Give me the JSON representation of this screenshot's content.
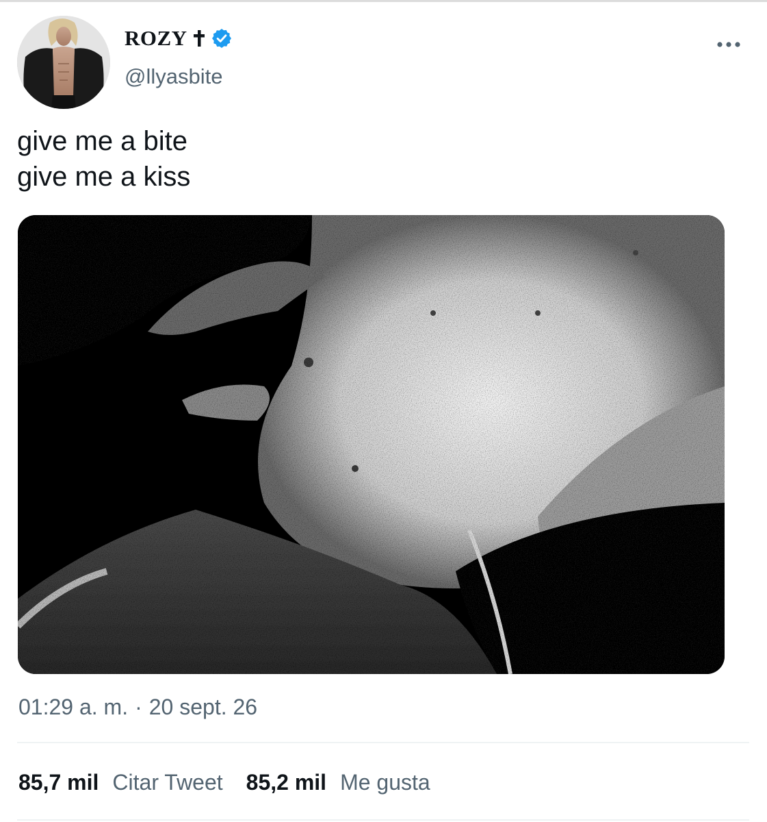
{
  "tweet": {
    "author": {
      "display_name": "ROZY",
      "name_icons": [
        "latin-cross-icon",
        "verified-badge-icon"
      ],
      "handle": "@llyasbite",
      "avatar": "profile-photo"
    },
    "text_lines": [
      "give me a bite",
      "give me a kiss"
    ],
    "media": "black-and-white-photo",
    "time": "01:29 a. m.",
    "separator": "·",
    "date": "20 sept. 26",
    "stats": {
      "quotes_count": "85,7 mil",
      "quotes_label": "Citar Tweet",
      "likes_count": "85,2 mil",
      "likes_label": "Me gusta"
    },
    "more_icon": "ellipsis-icon"
  },
  "colors": {
    "text": "#0f1419",
    "secondary_text": "#536471",
    "verified_blue": "#1d9bf0",
    "divider": "#eff3f4"
  }
}
